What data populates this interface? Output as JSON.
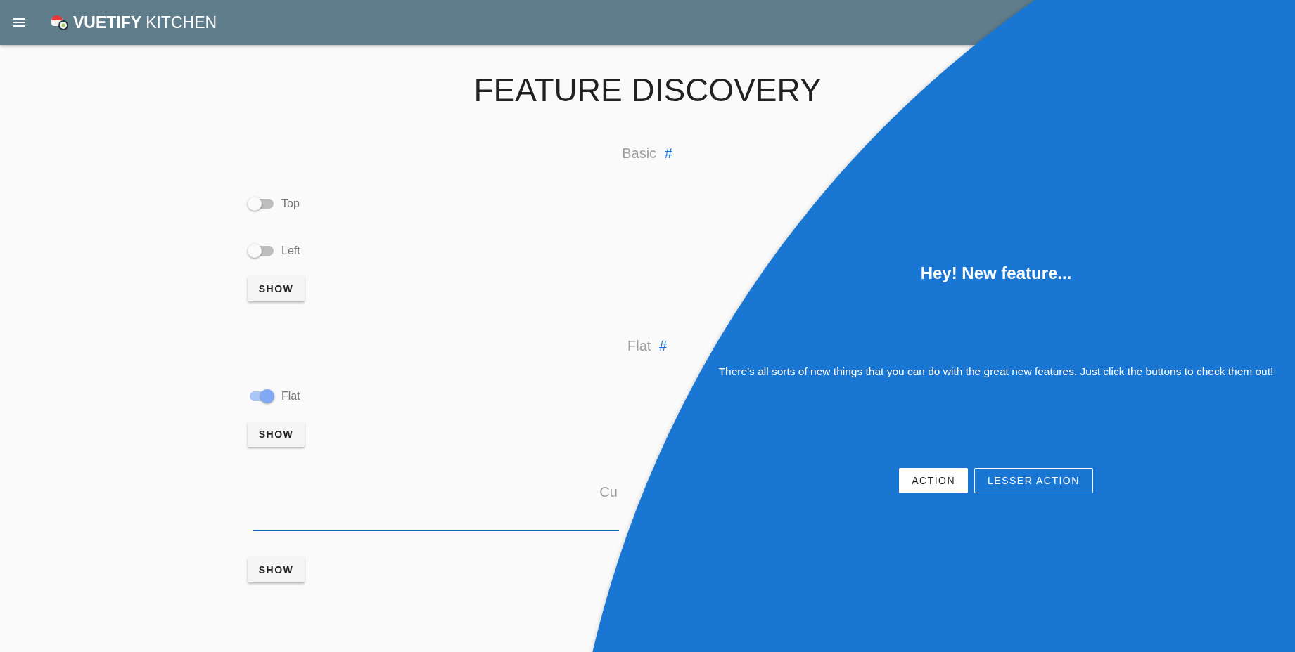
{
  "app_bar": {
    "title_bold": "VUETIFY",
    "title_light": "KITCHEN"
  },
  "page_title": "FEATURE DISCOVERY",
  "sections": [
    {
      "heading": "Basic",
      "anchor": "#",
      "switches": [
        {
          "label": "Top",
          "on": false
        },
        {
          "label": "Left",
          "on": false
        }
      ],
      "button": "SHOW"
    },
    {
      "heading": "Flat",
      "anchor": "#",
      "switches": [
        {
          "label": "Flat",
          "on": true
        }
      ],
      "button": "SHOW"
    },
    {
      "heading": "Cu",
      "field": {
        "focused": true
      },
      "button": "SHOW"
    }
  ],
  "feature_discovery": {
    "title": "Hey! New feature...",
    "text": "There's all sorts of new things that you can do with the great new features. Just click the buttons to check them out!",
    "buttons": [
      {
        "label": "ACTION",
        "kind": "primary"
      },
      {
        "label": "LESSER ACTION",
        "kind": "outlined"
      }
    ]
  }
}
